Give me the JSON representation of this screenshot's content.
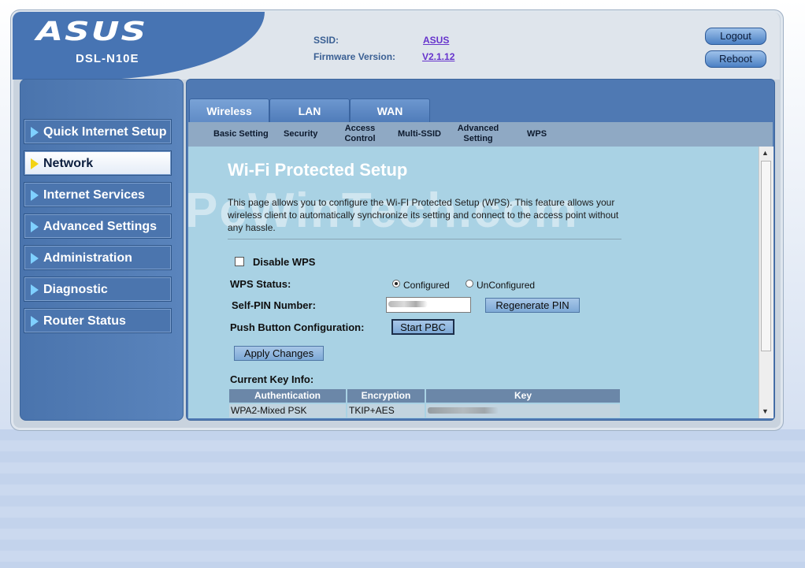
{
  "header": {
    "brand": "ASUS",
    "model": "DSL-N10E",
    "ssid_label": "SSID:",
    "ssid_value": "ASUS",
    "firmware_label": "Firmware Version:",
    "firmware_value": "V2.1.12",
    "logout_label": "Logout",
    "reboot_label": "Reboot"
  },
  "sidebar": {
    "items": [
      {
        "label": "Quick Internet Setup"
      },
      {
        "label": "Network",
        "active": true
      },
      {
        "label": "Internet Services"
      },
      {
        "label": "Advanced Settings"
      },
      {
        "label": "Administration"
      },
      {
        "label": "Diagnostic"
      },
      {
        "label": "Router Status"
      }
    ]
  },
  "tabs": [
    {
      "label": "Wireless",
      "active": true
    },
    {
      "label": "LAN"
    },
    {
      "label": "WAN"
    }
  ],
  "subnav": [
    {
      "label": "Basic Setting"
    },
    {
      "label": "Security"
    },
    {
      "label": "Access Control"
    },
    {
      "label": "Multi-SSID"
    },
    {
      "label": "Advanced Setting"
    },
    {
      "label": "WPS",
      "active": true
    }
  ],
  "watermark": "PcWinTech.com",
  "page": {
    "title": "Wi-Fi Protected Setup",
    "description": "This page allows you to configure the Wi-FI Protected Setup (WPS). This feature allows your wireless client to automatically synchronize its setting and connect to the access point without any hassle.",
    "disable_wps_label": "Disable WPS",
    "disable_wps_checked": false,
    "wps_status_label": "WPS Status:",
    "configured_label": "Configured",
    "unconfigured_label": "UnConfigured",
    "status_value": "Configured",
    "self_pin_label": "Self-PIN Number:",
    "regenerate_pin_label": "Regenerate PIN",
    "pbc_label": "Push Button Configuration:",
    "start_pbc_label": "Start PBC",
    "apply_label": "Apply Changes",
    "current_key_label": "Current Key Info:",
    "key_table": {
      "headers": [
        "Authentication",
        "Encryption",
        "Key"
      ],
      "rows": [
        [
          "WPA2-Mixed PSK",
          "TKIP+AES",
          ""
        ]
      ]
    }
  },
  "colors": {
    "brand_blue": "#4774b3",
    "panel_bg": "#a9d2e4",
    "active_arrow": "#f3d315",
    "menu_arrow": "#7fd0ff"
  }
}
